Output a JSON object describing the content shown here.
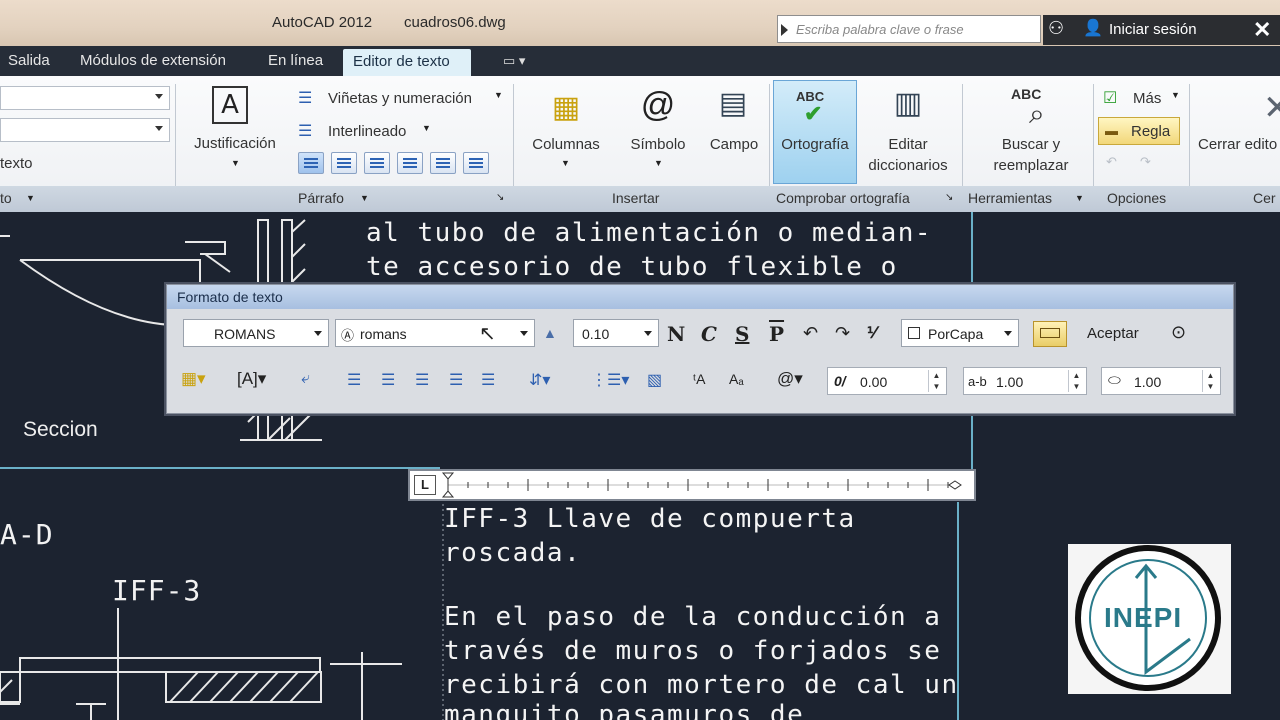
{
  "window": {
    "app": "AutoCAD 2012",
    "file": "cuadros06.dwg",
    "search_placeholder": "Escriba palabra clave o frase",
    "signin": "Iniciar sesión"
  },
  "tabs": [
    "Salida",
    "Módulos de extensión",
    "En línea",
    "Editor de texto"
  ],
  "ribbon": {
    "estilo": {
      "text_label": "texto",
      "panel": "to"
    },
    "parrafo": {
      "justificacion": "Justificación",
      "vinetas": "Viñetas y numeración",
      "interlineado": "Interlineado",
      "panel": "Párrafo"
    },
    "insertar": {
      "columnas": "Columnas",
      "simbolo": "Símbolo",
      "campo": "Campo",
      "panel": "Insertar"
    },
    "ortografia": {
      "icon_text": "ABC",
      "ortografia": "Ortografía",
      "editar1": "Editar",
      "editar2": "diccionarios",
      "panel": "Comprobar ortografía"
    },
    "herramientas": {
      "buscar1": "Buscar y",
      "buscar2": "reemplazar",
      "panel": "Herramientas"
    },
    "opciones": {
      "mas": "Más",
      "regla": "Regla",
      "panel": "Opciones"
    },
    "cerrar": {
      "label": "Cerrar edito",
      "panel": "Cer"
    }
  },
  "format_toolbar": {
    "title": "Formato de texto",
    "style": "ROMANS",
    "font": "romans",
    "height": "0.10",
    "bold": "N",
    "italic": "C",
    "underline": "S",
    "overline": "P",
    "color": "PorCapa",
    "accept": "Aceptar",
    "oblique": "0.00",
    "tracking_label": "a-b",
    "tracking": "1.00",
    "width": "1.00"
  },
  "drawing": {
    "top_text_1": "al tubo de alimentación o median-",
    "top_text_2": "te accesorio de tubo flexible o",
    "seccion": "Seccion",
    "label_ad": "A-D",
    "label_iff": "IFF-3",
    "editor_lines": [
      "IFF-3 Llave de compuerta",
      "roscada.",
      "En el paso de la conducción a",
      "través de muros o forjados se",
      "recibirá con mortero de cal un",
      "manguito pasamuros de"
    ],
    "logo_text": "INEPI"
  },
  "colors": {
    "drawing_bg": "#1c2330",
    "ribbon_active_tab": "#dff0f8",
    "toolbar_title": "#a7bfe0"
  }
}
